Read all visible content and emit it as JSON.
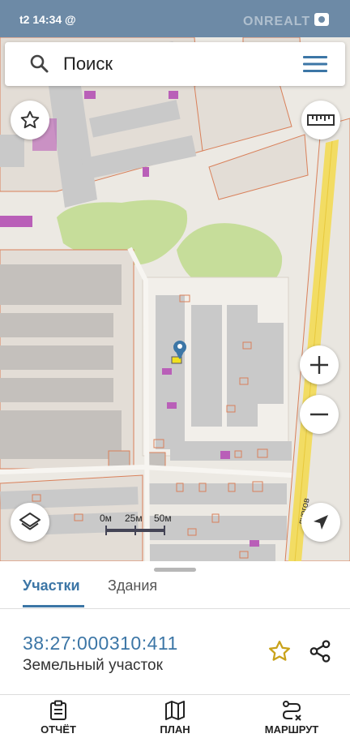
{
  "status_bar": {
    "time": "t2 14:34 @",
    "watermark": "ONREALT"
  },
  "search": {
    "placeholder": "Поиск",
    "icon": "search-icon",
    "menu_icon": "menu-icon"
  },
  "map_controls": {
    "favorites_icon": "star-outline-icon",
    "ruler_icon": "ruler-icon",
    "zoom_in_icon": "plus-icon",
    "zoom_out_icon": "minus-icon",
    "layers_icon": "layers-icon",
    "locate_icon": "navigation-arrow-icon"
  },
  "map": {
    "street_label": "лургов",
    "scale": {
      "labels": [
        "0м",
        "25м",
        "50м"
      ]
    },
    "marker_icon": "location-pin-icon"
  },
  "sheet": {
    "tabs": [
      {
        "label": "Участки",
        "active": true
      },
      {
        "label": "Здания",
        "active": false
      }
    ],
    "parcel": {
      "id": "38:27:000310:411",
      "type": "Земельный участок"
    },
    "actions": {
      "favorite_icon": "star-outline-icon",
      "share_icon": "share-icon"
    }
  },
  "bottom_nav": [
    {
      "label": "ОТЧЁТ",
      "icon": "report-clipboard-icon"
    },
    {
      "label": "ПЛАН",
      "icon": "map-plan-icon"
    },
    {
      "label": "МАРШРУТ",
      "icon": "route-icon"
    }
  ],
  "colors": {
    "accent": "#3c76a6",
    "status_bar": "#6d8aa6",
    "map_bg": "#ece9e3",
    "building": "#c8c8c8",
    "parcel_border": "#d9805a",
    "green": "#c6dd9a",
    "road_yellow": "#f2dc63"
  }
}
